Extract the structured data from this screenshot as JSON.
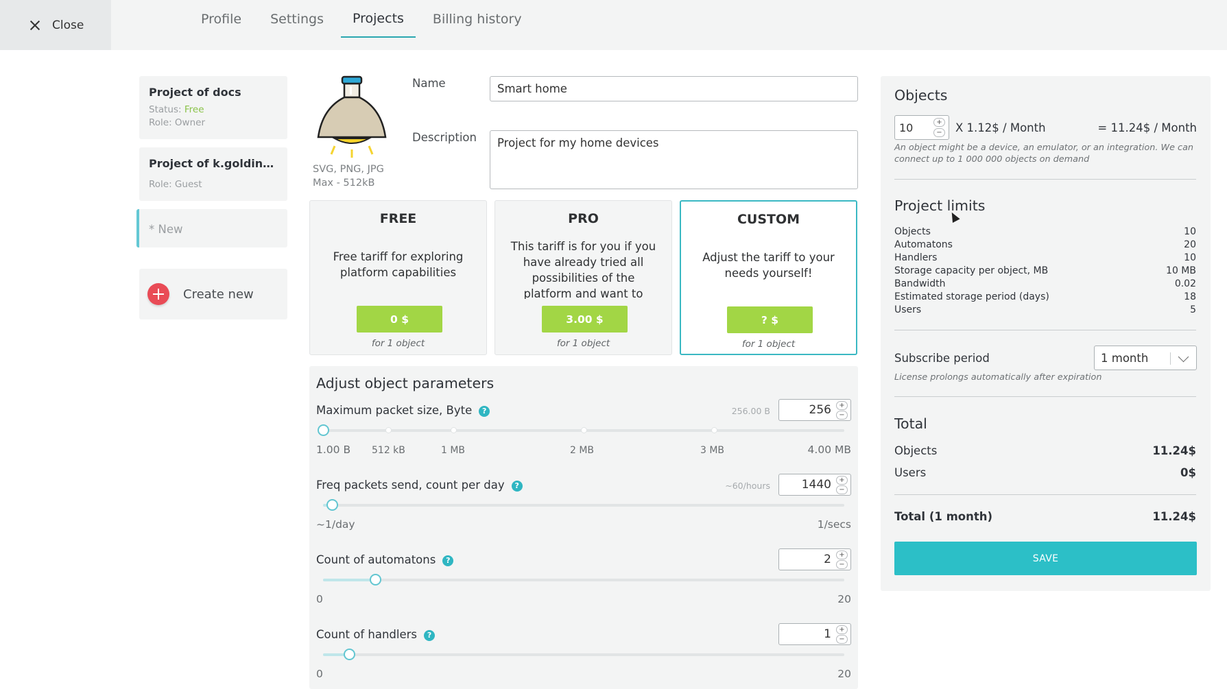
{
  "header": {
    "close_label": "Close",
    "tabs": [
      {
        "label": "Profile",
        "active": false
      },
      {
        "label": "Settings",
        "active": false
      },
      {
        "label": "Projects",
        "active": true
      },
      {
        "label": "Billing history",
        "active": false
      }
    ]
  },
  "projects": [
    {
      "name": "Project of docs",
      "status_label": "Status:",
      "status_value": "Free",
      "role": "Role: Owner"
    },
    {
      "name": "Project of k.goldinova...",
      "role": "Role: Guest"
    }
  ],
  "new_project_label": "* New",
  "create_new_label": "Create new",
  "avatar": {
    "formats": "SVG, PNG, JPG",
    "max_size": "Max - 512kB"
  },
  "form": {
    "name_label": "Name",
    "name_value": "Smart home",
    "description_label": "Description",
    "description_value": "Project for my home devices"
  },
  "tariffs": [
    {
      "name": "FREE",
      "description": "Free tariff for exploring platform capabilities",
      "price": "0 $",
      "unit": "for 1 object",
      "selected": false
    },
    {
      "name": "PRO",
      "description": "This tariff is for you if you have already tried all possibilities of the platform and want to scale your",
      "price": "3.00 $",
      "unit": "for 1 object",
      "selected": false
    },
    {
      "name": "CUSTOM",
      "description": "Adjust the tariff to your needs yourself!",
      "price": "? $",
      "unit": "for 1 object",
      "selected": true
    }
  ],
  "adjust": {
    "title": "Adjust object parameters",
    "params": [
      {
        "label": "Maximum packet size, Byte",
        "hint": "256.00 B",
        "value": "256",
        "position": 0.0,
        "ticks": [
          "1.00 B",
          "512 kB",
          "1 MB",
          "2 MB",
          "3 MB",
          "4.00 MB"
        ]
      },
      {
        "label": "Freq packets send, count per day",
        "hint": "~60/hours",
        "value": "1440",
        "position": 0.017,
        "ticks": [
          "~1/day",
          "1/secs"
        ]
      },
      {
        "label": "Count of automatons",
        "hint": "",
        "value": "2",
        "position": 0.1,
        "ticks": [
          "0",
          "20"
        ]
      },
      {
        "label": "Count of handlers",
        "hint": "",
        "value": "1",
        "position": 0.05,
        "ticks": [
          "0",
          "20"
        ]
      }
    ]
  },
  "summary": {
    "objects_title": "Objects",
    "objects_count": "10",
    "price_per": "X 1.12$ / Month",
    "price_total": "= 11.24$ / Month",
    "objects_note": "An object might be a device, an emulator, or an integration. We can connect up to 1 000 000 objects on demand",
    "limits_title": "Project limits",
    "limits": [
      {
        "label": "Objects",
        "value": "10"
      },
      {
        "label": "Automatons",
        "value": "20"
      },
      {
        "label": "Handlers",
        "value": "10"
      },
      {
        "label": "Storage capacity per object, MB",
        "value": "10 MB"
      },
      {
        "label": "Bandwidth",
        "value": "0.02"
      },
      {
        "label": "Estimated storage period (days)",
        "value": "18"
      },
      {
        "label": "Users",
        "value": "5"
      }
    ],
    "subscribe_label": "Subscribe period",
    "subscribe_value": "1 month",
    "subscribe_note": "License prolongs automatically after expiration",
    "total_title": "Total",
    "total_rows": [
      {
        "label": "Objects",
        "value": "11.24$"
      },
      {
        "label": "Users",
        "value": "0$"
      }
    ],
    "grand_label": "Total (1 month)",
    "grand_value": "11.24$",
    "save_label": "SAVE"
  },
  "colors": {
    "accent": "#2cbfc7",
    "price_button": "#a2d645",
    "danger": "#e94b56",
    "free_status": "#8bc34a"
  }
}
